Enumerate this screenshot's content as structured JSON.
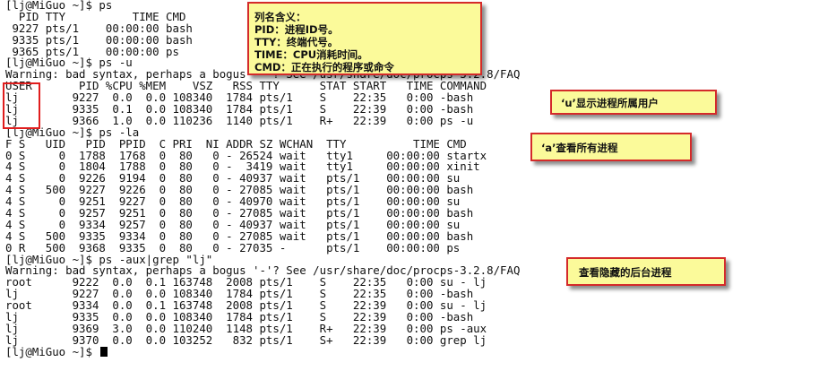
{
  "terminal": {
    "lines": [
      "[lj@MiGuo ~]$ ps",
      "  PID TTY          TIME CMD",
      " 9227 pts/1    00:00:00 bash",
      " 9335 pts/1    00:00:00 bash",
      " 9365 pts/1    00:00:00 ps",
      "[lj@MiGuo ~]$ ps -u",
      "Warning: bad syntax, perhaps a bogus '-'? See /usr/share/doc/procps-3.2.8/FAQ",
      "USER       PID %CPU %MEM    VSZ   RSS TTY      STAT START   TIME COMMAND",
      "lj        9227  0.0  0.0 108340  1784 pts/1    S    22:35   0:00 -bash",
      "lj        9335  0.1  0.0 108340  1784 pts/1    S    22:39   0:00 -bash",
      "lj        9366  1.0  0.0 110236  1140 pts/1    R+   22:39   0:00 ps -u",
      "[lj@MiGuo ~]$ ps -la",
      "F S   UID   PID  PPID  C PRI  NI ADDR SZ WCHAN  TTY          TIME CMD",
      "0 S     0  1788  1768  0  80   0 - 26524 wait   tty1     00:00:00 startx",
      "4 S     0  1804  1788  0  80   0 -  3419 wait   tty1     00:00:00 xinit",
      "4 S     0  9226  9194  0  80   0 - 40937 wait   pts/1    00:00:00 su",
      "4 S   500  9227  9226  0  80   0 - 27085 wait   pts/1    00:00:00 bash",
      "4 S     0  9251  9227  0  80   0 - 40970 wait   pts/1    00:00:00 su",
      "4 S     0  9257  9251  0  80   0 - 27085 wait   pts/1    00:00:00 bash",
      "4 S     0  9334  9257  0  80   0 - 40937 wait   pts/1    00:00:00 su",
      "4 S   500  9335  9334  0  80   0 - 27085 wait   pts/1    00:00:00 bash",
      "0 R   500  9368  9335  0  80   0 - 27035 -      pts/1    00:00:00 ps",
      "[lj@MiGuo ~]$ ps -aux|grep \"lj\"",
      "Warning: bad syntax, perhaps a bogus '-'? See /usr/share/doc/procps-3.2.8/FAQ",
      "root      9222  0.0  0.1 163748  2008 pts/1    S    22:35   0:00 su - lj",
      "lj        9227  0.0  0.0 108340  1784 pts/1    S    22:35   0:00 -bash",
      "root      9334  0.0  0.1 163748  2008 pts/1    S    22:39   0:00 su - lj",
      "lj        9335  0.0  0.0 108340  1784 pts/1    S    22:39   0:00 -bash",
      "lj        9369  3.0  0.0 110240  1148 pts/1    R+   22:39   0:00 ps -aux",
      "lj        9370  0.0  0.0 103252   832 pts/1    S+   22:39   0:00 grep lj"
    ],
    "prompt": "[lj@MiGuo ~]$ "
  },
  "annotations": {
    "legend": {
      "lines": [
        "列名含义：",
        "PID：进程ID号。",
        "TTY：终端代号。",
        "TIME：CPU消耗时间。",
        "CMD：正在执行的程序或命令"
      ]
    },
    "u_note": "‘u’显示进程所属用户",
    "a_note": "‘a’查看所有进程",
    "grep_note": "查看隐藏的后台进程"
  },
  "colors": {
    "note_bg": "#fbfa9a",
    "note_border": "#d42a2a",
    "highlight_box": "#e01e1e",
    "terminal_text": "#111111"
  }
}
